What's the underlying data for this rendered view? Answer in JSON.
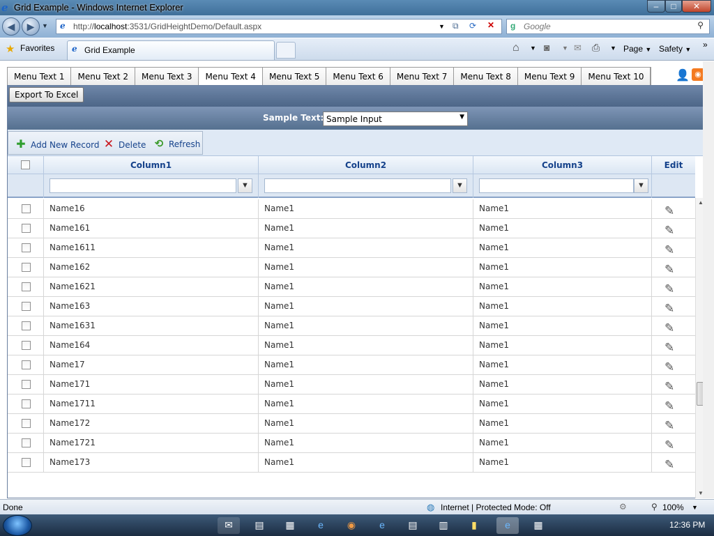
{
  "window": {
    "title": "Grid Example - Windows Internet Explorer"
  },
  "browser": {
    "address": {
      "prefix": "http://",
      "host": "localhost",
      "rest": ":3531/GridHeightDemo/Default.aspx"
    },
    "search_placeholder": "Google",
    "favorites_label": "Favorites",
    "tab_title": "Grid Example",
    "commands": {
      "page": "Page",
      "safety": "Safety"
    }
  },
  "menu": {
    "items": [
      "Menu Text 1",
      "Menu Text 2",
      "Menu Text 3",
      "Menu Text 4",
      "Menu Text 5",
      "Menu Text 6",
      "Menu Text 7",
      "Menu Text 8",
      "Menu Text 9",
      "Menu Text 10"
    ],
    "selected_index": 3
  },
  "grid": {
    "export_label": "Export To Excel",
    "sample_label": "Sample Text:",
    "sample_value": "Sample Input",
    "commands": {
      "add": "Add New Record",
      "delete": "Delete",
      "refresh": "Refresh"
    },
    "columns": {
      "c1": "Column1",
      "c2": "Column2",
      "c3": "Column3",
      "edit": "Edit"
    },
    "rows": [
      [
        "Name16",
        "Name1",
        "Name1"
      ],
      [
        "Name161",
        "Name1",
        "Name1"
      ],
      [
        "Name1611",
        "Name1",
        "Name1"
      ],
      [
        "Name162",
        "Name1",
        "Name1"
      ],
      [
        "Name1621",
        "Name1",
        "Name1"
      ],
      [
        "Name163",
        "Name1",
        "Name1"
      ],
      [
        "Name1631",
        "Name1",
        "Name1"
      ],
      [
        "Name164",
        "Name1",
        "Name1"
      ],
      [
        "Name17",
        "Name1",
        "Name1"
      ],
      [
        "Name171",
        "Name1",
        "Name1"
      ],
      [
        "Name1711",
        "Name1",
        "Name1"
      ],
      [
        "Name172",
        "Name1",
        "Name1"
      ],
      [
        "Name1721",
        "Name1",
        "Name1"
      ],
      [
        "Name173",
        "Name1",
        "Name1"
      ]
    ]
  },
  "status": {
    "left": "Done",
    "zone": "Internet | Protected Mode: Off",
    "zoom": "100%"
  },
  "taskbar": {
    "clock": "12:36 PM"
  },
  "icons": {
    "pen": "pencil-icon",
    "filter": "filter-icon",
    "add": "plus-icon",
    "delete": "x-icon",
    "refresh": "refresh-icon"
  }
}
